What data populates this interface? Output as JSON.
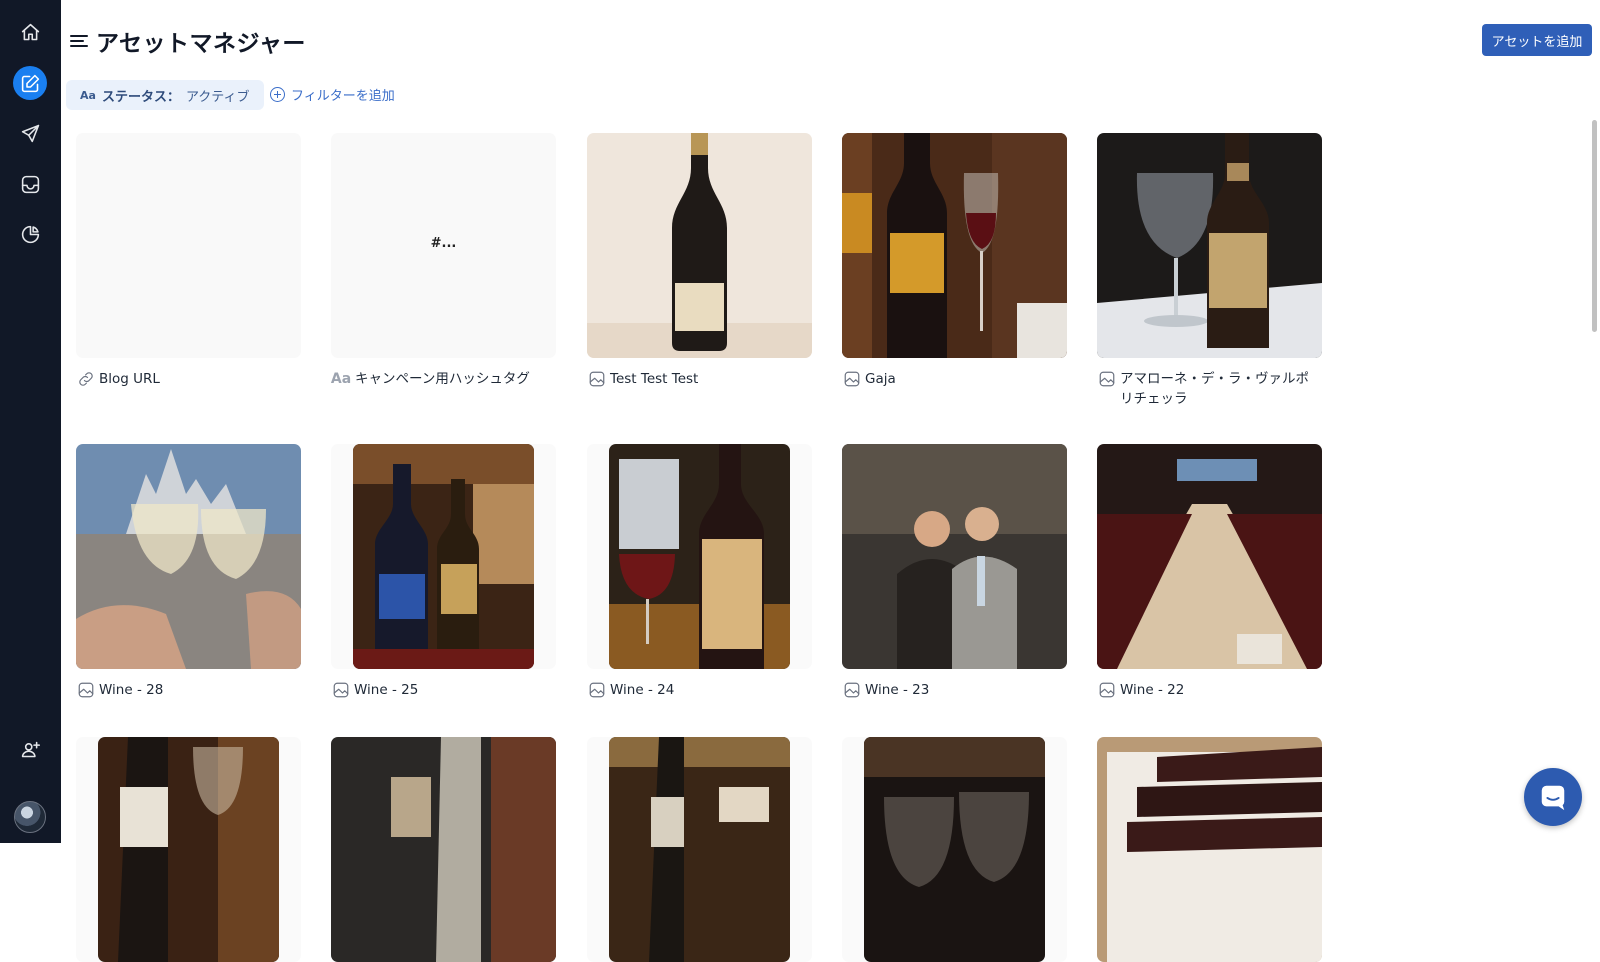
{
  "app": {
    "title": "アセットマネジャー",
    "add_button_label": "アセットを追加"
  },
  "sidebar": {
    "items": [
      {
        "name": "home-icon",
        "active": false
      },
      {
        "name": "edit-icon",
        "active": true
      },
      {
        "name": "send-icon",
        "active": false
      },
      {
        "name": "inbox-icon",
        "active": false
      },
      {
        "name": "pie-chart-icon",
        "active": false
      },
      {
        "name": "add-user-icon",
        "active": false
      }
    ]
  },
  "filters": {
    "chip_prefix": "Aa",
    "chip_key": "ステータス：",
    "chip_value": "アクティブ",
    "add_filter_label": "フィルターを追加"
  },
  "assets": [
    {
      "type": "link",
      "label": "Blog URL",
      "preview_text": ""
    },
    {
      "type": "text",
      "label": "キャンペーン用ハッシュタグ",
      "preview_text": "#..."
    },
    {
      "type": "image",
      "label": "Test Test Test"
    },
    {
      "type": "image",
      "label": "Gaja"
    },
    {
      "type": "image",
      "label": "アマローネ・デ・ラ・ヴァルポリチェッラ"
    },
    {
      "type": "image",
      "label": "Wine - 28"
    },
    {
      "type": "image",
      "label": "Wine - 25"
    },
    {
      "type": "image",
      "label": "Wine - 24"
    },
    {
      "type": "image",
      "label": "Wine - 23"
    },
    {
      "type": "image",
      "label": "Wine - 22"
    },
    {
      "type": "image",
      "label": ""
    },
    {
      "type": "image",
      "label": ""
    },
    {
      "type": "image",
      "label": ""
    },
    {
      "type": "image",
      "label": ""
    },
    {
      "type": "image",
      "label": ""
    }
  ],
  "colors": {
    "sidebar": "#111827",
    "accent": "#1a7ff0",
    "primary_button": "#2f5fb8"
  }
}
